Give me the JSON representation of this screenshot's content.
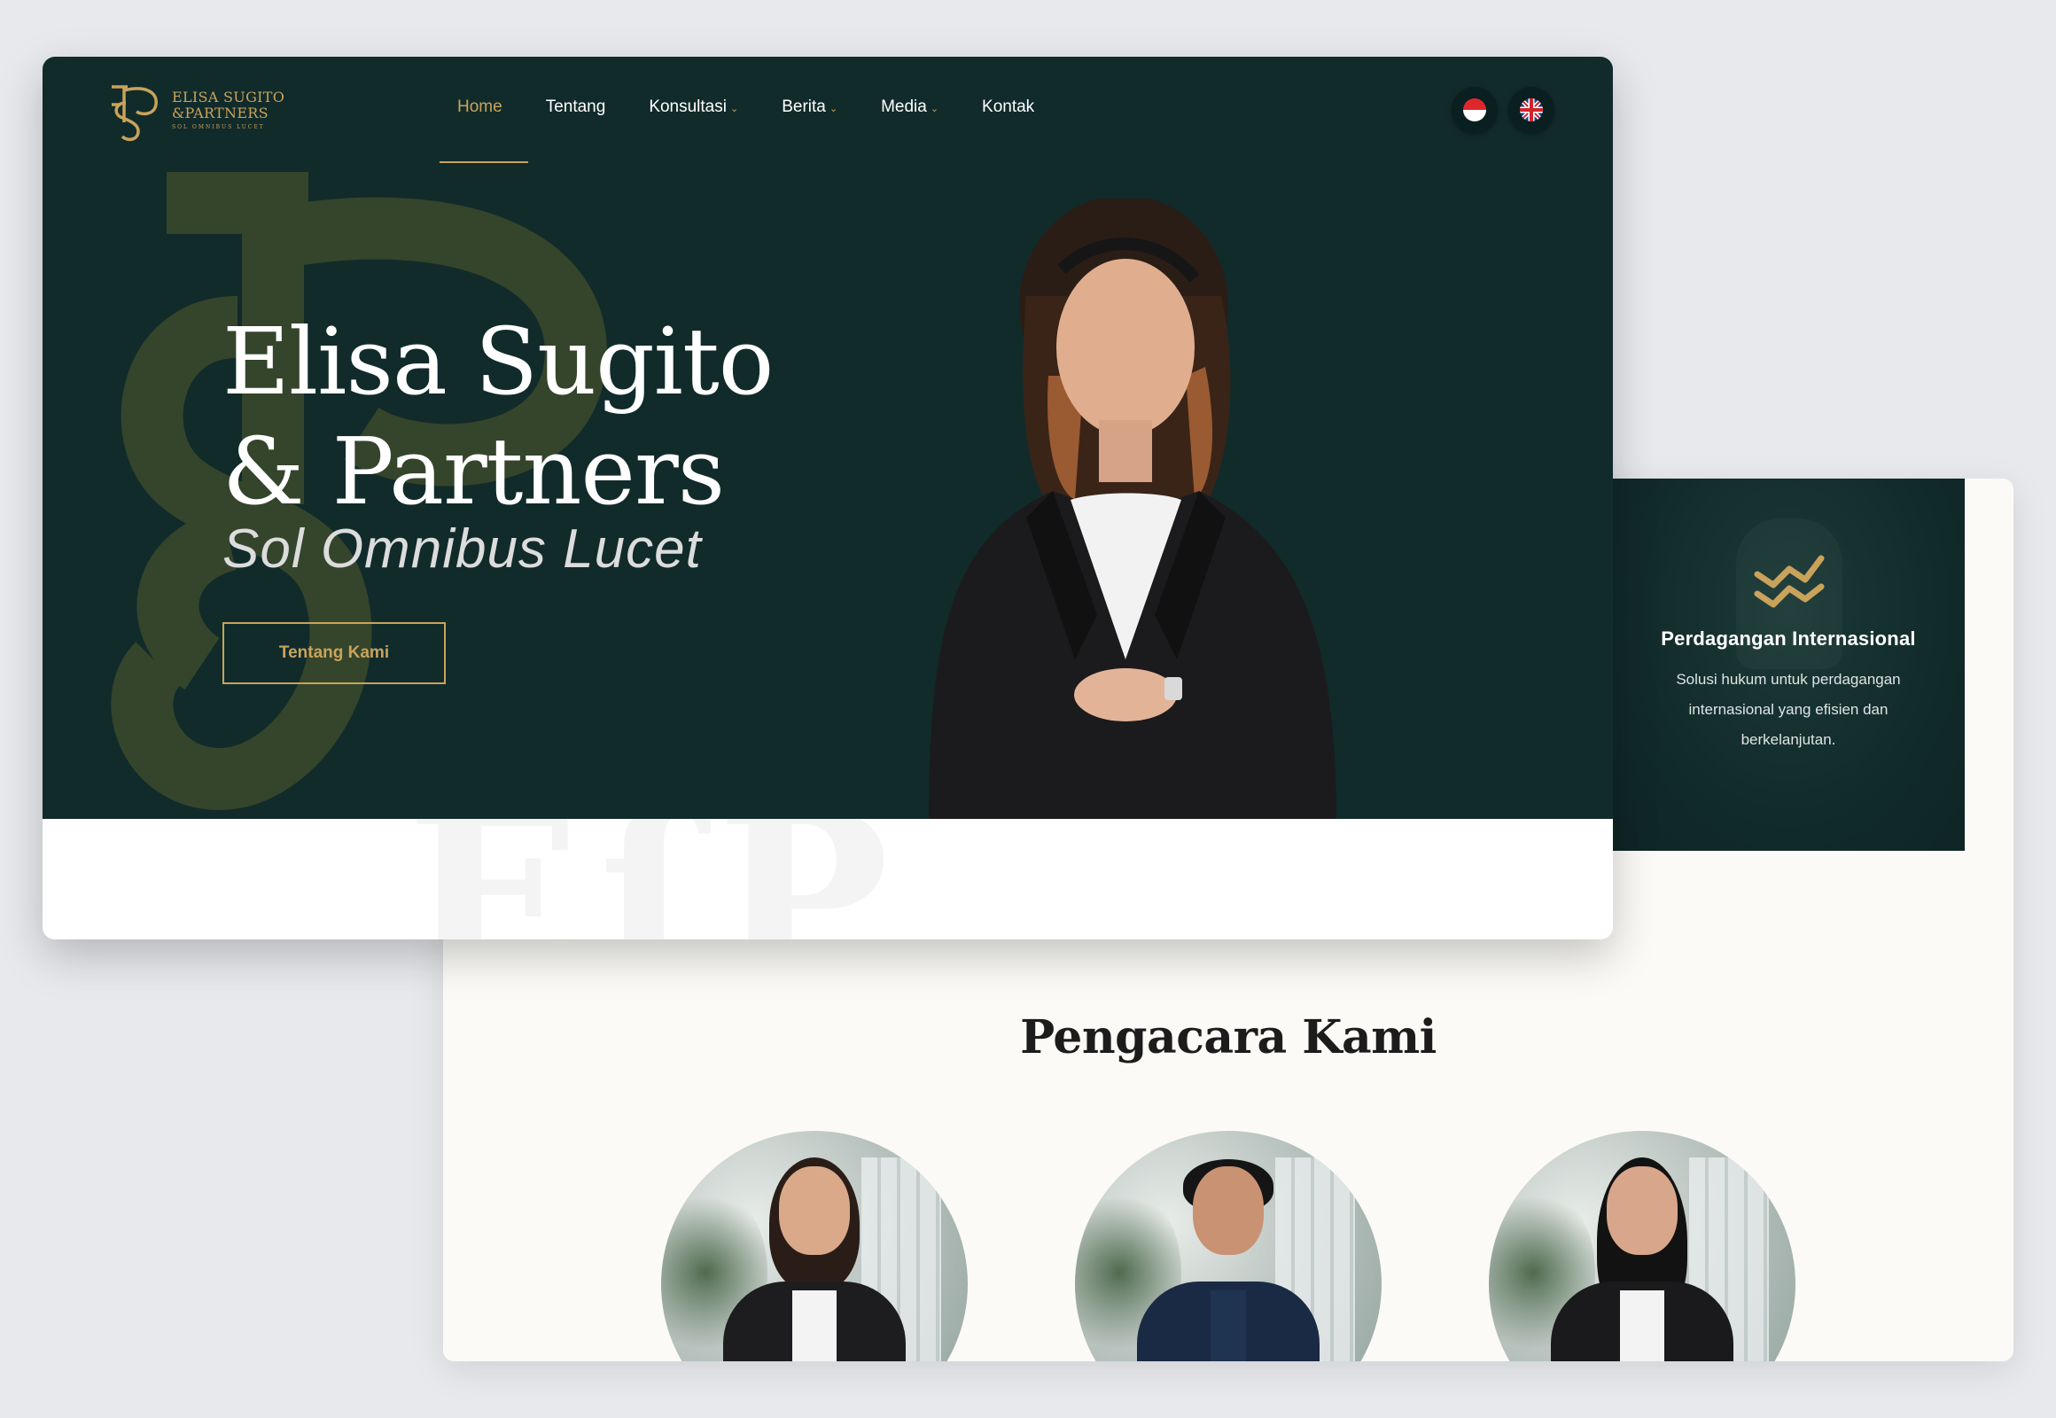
{
  "brand": {
    "name_line1": "ELISA SUGITO",
    "name_line2": "&PARTNERS",
    "motto_small": "SOL OMNIBUS LUCET",
    "gold": "#c9a35b",
    "dark_green": "#112b2b"
  },
  "nav": {
    "items": [
      {
        "label": "Home",
        "active": true,
        "dropdown": false
      },
      {
        "label": "Tentang",
        "active": false,
        "dropdown": false
      },
      {
        "label": "Konsultasi",
        "active": false,
        "dropdown": true
      },
      {
        "label": "Berita",
        "active": false,
        "dropdown": true
      },
      {
        "label": "Media",
        "active": false,
        "dropdown": true
      },
      {
        "label": "Kontak",
        "active": false,
        "dropdown": false
      }
    ],
    "languages": [
      {
        "icon": "indonesia-flag-icon"
      },
      {
        "icon": "uk-flag-icon"
      }
    ]
  },
  "hero": {
    "title_line1": "Elisa Sugito",
    "title_line2": "&  Partners",
    "tagline": "Sol Omnibus Lucet",
    "button_label": "Tentang Kami"
  },
  "service_card": {
    "icon": "trade-zigzag-icon",
    "title": "Perdagangan Internasional",
    "description": "Solusi hukum untuk perdagangan internasional yang efisien dan berkelanjutan."
  },
  "lawyers": {
    "title": "Pengacara Kami",
    "photos": [
      "lawyer-photo-1",
      "lawyer-photo-2",
      "lawyer-photo-3"
    ]
  }
}
